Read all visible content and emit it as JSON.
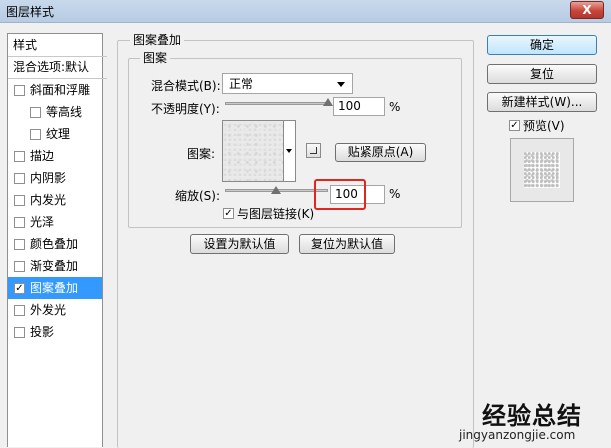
{
  "window": {
    "title": "图层样式",
    "close_label": "X"
  },
  "style_list": {
    "header": "样式",
    "blend_default": "混合选项:默认",
    "items": [
      {
        "label": "斜面和浮雕",
        "checked": false
      },
      {
        "label": "等高线",
        "checked": false
      },
      {
        "label": "纹理",
        "checked": false
      },
      {
        "label": "描边",
        "checked": false
      },
      {
        "label": "内阴影",
        "checked": false
      },
      {
        "label": "内发光",
        "checked": false
      },
      {
        "label": "光泽",
        "checked": false
      },
      {
        "label": "颜色叠加",
        "checked": false
      },
      {
        "label": "渐变叠加",
        "checked": false
      },
      {
        "label": "图案叠加",
        "checked": true
      },
      {
        "label": "外发光",
        "checked": false
      },
      {
        "label": "投影",
        "checked": false
      }
    ],
    "check_mark": "✓"
  },
  "panel": {
    "group_title": "图案叠加",
    "subgroup_title": "图案",
    "blend_mode_label": "混合模式(B):",
    "blend_mode_value": "正常",
    "opacity_label": "不透明度(Y):",
    "opacity_value": "100",
    "opacity_percent": 100,
    "percent_sign": "%",
    "pattern_label": "图案:",
    "snap_origin_button": "贴紧原点(A)",
    "scale_label": "缩放(S):",
    "scale_value": "100",
    "scale_percent": 100,
    "link_layer_label": "与图层链接(K)",
    "link_layer_checked": true,
    "set_default_button": "设置为默认值",
    "reset_default_button": "复位为默认值"
  },
  "actions": {
    "ok": "确定",
    "reset": "复位",
    "new_style": "新建样式(W)...",
    "preview_label": "预览(V)",
    "preview_checked": true
  },
  "watermark": {
    "title": "经验总结",
    "url": "jingyanzongjie.com"
  },
  "colors": {
    "selection": "#3399ff",
    "highlight": "#e0261d",
    "titlebar": "#c1d3ea"
  }
}
